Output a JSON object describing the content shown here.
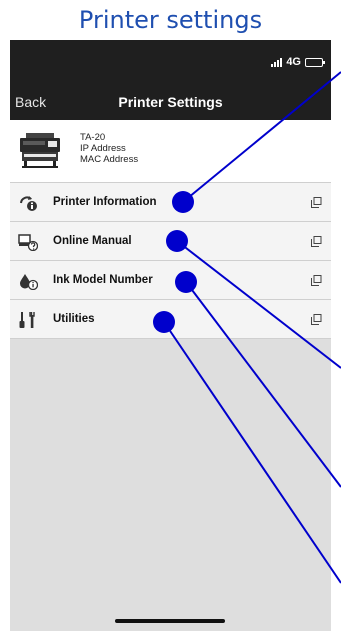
{
  "caption": "Printer settings",
  "status": {
    "network": "4G"
  },
  "nav": {
    "back": "Back",
    "title": "Printer Settings"
  },
  "printer": {
    "model": "TA-20",
    "ip": "IP Address",
    "mac": "MAC Address"
  },
  "menu": [
    {
      "label": "Printer Information",
      "icon": "printer-info-icon"
    },
    {
      "label": "Online Manual",
      "icon": "online-manual-icon"
    },
    {
      "label": "Ink Model Number",
      "icon": "ink-model-icon"
    },
    {
      "label": "Utilities",
      "icon": "utilities-icon"
    }
  ],
  "colors": {
    "callout": "#0000cc",
    "caption": "#1f4fb0",
    "bar": "#1f1f1f"
  }
}
